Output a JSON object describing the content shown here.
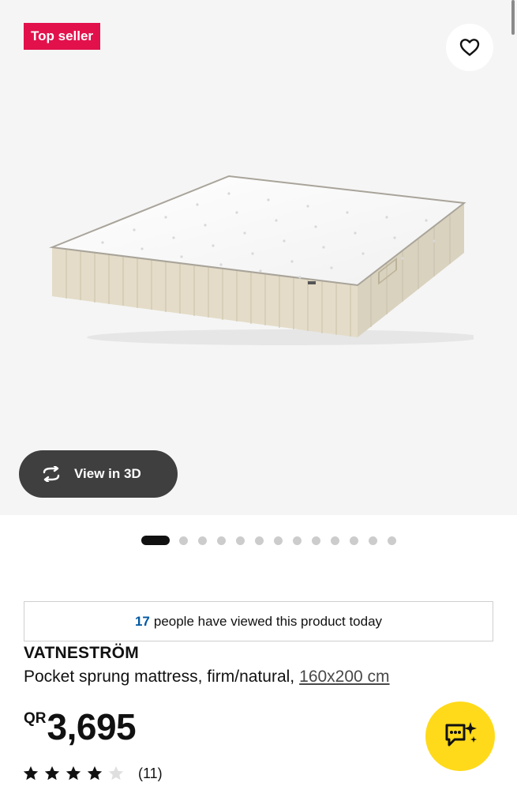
{
  "hero": {
    "badge_label": "Top seller",
    "favorite_icon": "heart-outline-icon",
    "view_3d_label": "View in 3D",
    "view_3d_icon": "rotate-arrows-icon",
    "carousel": {
      "total_images": 13,
      "active_index": 0
    }
  },
  "viewers": {
    "count": "17",
    "text": "people have viewed this product today"
  },
  "product": {
    "name": "VATNESTRÖM",
    "description": "Pocket sprung mattress, firm/natural,",
    "size_link": "160x200 cm",
    "currency": "QR",
    "price": "3,695",
    "rating": {
      "value": 4,
      "max": 5,
      "count_label": "(11)"
    }
  },
  "assistant_button_icon": "chat-sparkle-icon",
  "colors": {
    "badge": "#e2114c",
    "link_blue": "#0058a3",
    "assistant_yellow": "#ffda1a",
    "pill_dark": "#3f3f3f"
  }
}
